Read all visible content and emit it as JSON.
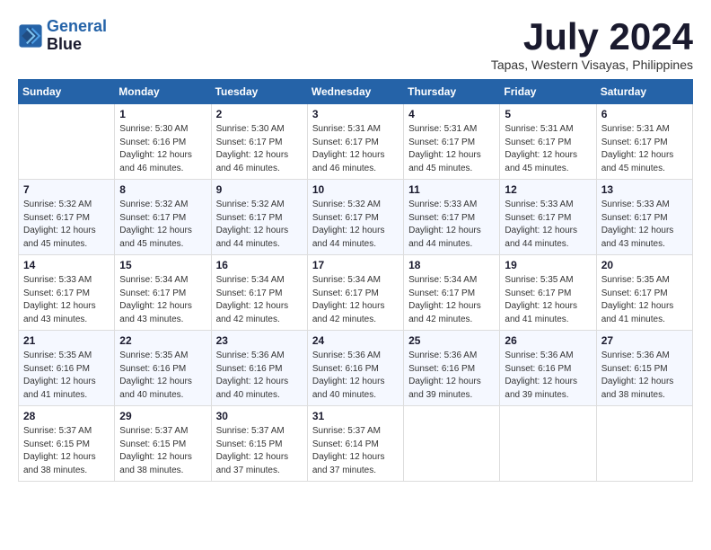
{
  "logo": {
    "line1": "General",
    "line2": "Blue"
  },
  "header": {
    "month": "July 2024",
    "location": "Tapas, Western Visayas, Philippines"
  },
  "columns": [
    "Sunday",
    "Monday",
    "Tuesday",
    "Wednesday",
    "Thursday",
    "Friday",
    "Saturday"
  ],
  "weeks": [
    [
      {
        "day": "",
        "text": ""
      },
      {
        "day": "1",
        "text": "Sunrise: 5:30 AM\nSunset: 6:16 PM\nDaylight: 12 hours\nand 46 minutes."
      },
      {
        "day": "2",
        "text": "Sunrise: 5:30 AM\nSunset: 6:17 PM\nDaylight: 12 hours\nand 46 minutes."
      },
      {
        "day": "3",
        "text": "Sunrise: 5:31 AM\nSunset: 6:17 PM\nDaylight: 12 hours\nand 46 minutes."
      },
      {
        "day": "4",
        "text": "Sunrise: 5:31 AM\nSunset: 6:17 PM\nDaylight: 12 hours\nand 45 minutes."
      },
      {
        "day": "5",
        "text": "Sunrise: 5:31 AM\nSunset: 6:17 PM\nDaylight: 12 hours\nand 45 minutes."
      },
      {
        "day": "6",
        "text": "Sunrise: 5:31 AM\nSunset: 6:17 PM\nDaylight: 12 hours\nand 45 minutes."
      }
    ],
    [
      {
        "day": "7",
        "text": "Sunrise: 5:32 AM\nSunset: 6:17 PM\nDaylight: 12 hours\nand 45 minutes."
      },
      {
        "day": "8",
        "text": "Sunrise: 5:32 AM\nSunset: 6:17 PM\nDaylight: 12 hours\nand 45 minutes."
      },
      {
        "day": "9",
        "text": "Sunrise: 5:32 AM\nSunset: 6:17 PM\nDaylight: 12 hours\nand 44 minutes."
      },
      {
        "day": "10",
        "text": "Sunrise: 5:32 AM\nSunset: 6:17 PM\nDaylight: 12 hours\nand 44 minutes."
      },
      {
        "day": "11",
        "text": "Sunrise: 5:33 AM\nSunset: 6:17 PM\nDaylight: 12 hours\nand 44 minutes."
      },
      {
        "day": "12",
        "text": "Sunrise: 5:33 AM\nSunset: 6:17 PM\nDaylight: 12 hours\nand 44 minutes."
      },
      {
        "day": "13",
        "text": "Sunrise: 5:33 AM\nSunset: 6:17 PM\nDaylight: 12 hours\nand 43 minutes."
      }
    ],
    [
      {
        "day": "14",
        "text": "Sunrise: 5:33 AM\nSunset: 6:17 PM\nDaylight: 12 hours\nand 43 minutes."
      },
      {
        "day": "15",
        "text": "Sunrise: 5:34 AM\nSunset: 6:17 PM\nDaylight: 12 hours\nand 43 minutes."
      },
      {
        "day": "16",
        "text": "Sunrise: 5:34 AM\nSunset: 6:17 PM\nDaylight: 12 hours\nand 42 minutes."
      },
      {
        "day": "17",
        "text": "Sunrise: 5:34 AM\nSunset: 6:17 PM\nDaylight: 12 hours\nand 42 minutes."
      },
      {
        "day": "18",
        "text": "Sunrise: 5:34 AM\nSunset: 6:17 PM\nDaylight: 12 hours\nand 42 minutes."
      },
      {
        "day": "19",
        "text": "Sunrise: 5:35 AM\nSunset: 6:17 PM\nDaylight: 12 hours\nand 41 minutes."
      },
      {
        "day": "20",
        "text": "Sunrise: 5:35 AM\nSunset: 6:17 PM\nDaylight: 12 hours\nand 41 minutes."
      }
    ],
    [
      {
        "day": "21",
        "text": "Sunrise: 5:35 AM\nSunset: 6:16 PM\nDaylight: 12 hours\nand 41 minutes."
      },
      {
        "day": "22",
        "text": "Sunrise: 5:35 AM\nSunset: 6:16 PM\nDaylight: 12 hours\nand 40 minutes."
      },
      {
        "day": "23",
        "text": "Sunrise: 5:36 AM\nSunset: 6:16 PM\nDaylight: 12 hours\nand 40 minutes."
      },
      {
        "day": "24",
        "text": "Sunrise: 5:36 AM\nSunset: 6:16 PM\nDaylight: 12 hours\nand 40 minutes."
      },
      {
        "day": "25",
        "text": "Sunrise: 5:36 AM\nSunset: 6:16 PM\nDaylight: 12 hours\nand 39 minutes."
      },
      {
        "day": "26",
        "text": "Sunrise: 5:36 AM\nSunset: 6:16 PM\nDaylight: 12 hours\nand 39 minutes."
      },
      {
        "day": "27",
        "text": "Sunrise: 5:36 AM\nSunset: 6:15 PM\nDaylight: 12 hours\nand 38 minutes."
      }
    ],
    [
      {
        "day": "28",
        "text": "Sunrise: 5:37 AM\nSunset: 6:15 PM\nDaylight: 12 hours\nand 38 minutes."
      },
      {
        "day": "29",
        "text": "Sunrise: 5:37 AM\nSunset: 6:15 PM\nDaylight: 12 hours\nand 38 minutes."
      },
      {
        "day": "30",
        "text": "Sunrise: 5:37 AM\nSunset: 6:15 PM\nDaylight: 12 hours\nand 37 minutes."
      },
      {
        "day": "31",
        "text": "Sunrise: 5:37 AM\nSunset: 6:14 PM\nDaylight: 12 hours\nand 37 minutes."
      },
      {
        "day": "",
        "text": ""
      },
      {
        "day": "",
        "text": ""
      },
      {
        "day": "",
        "text": ""
      }
    ]
  ]
}
